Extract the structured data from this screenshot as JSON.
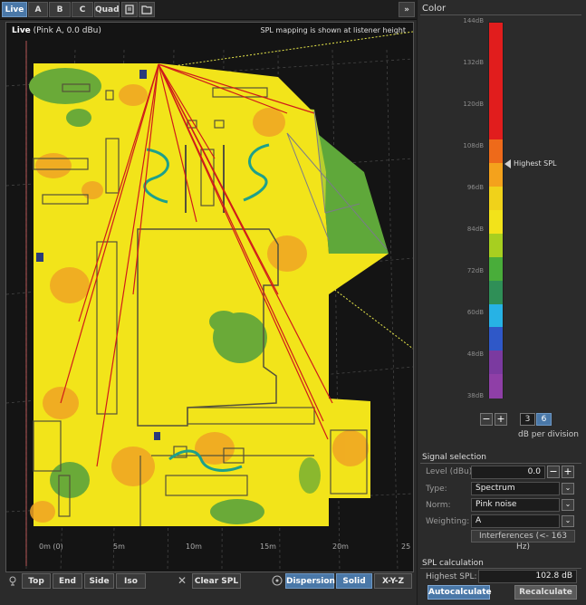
{
  "tabs": [
    "Live",
    "A",
    "B",
    "C",
    "Quad"
  ],
  "tab_icons": [
    "notes-icon",
    "folder-icon"
  ],
  "expand_glyph": "»",
  "viewport": {
    "title": "Live",
    "subtitle": "(Pink A, 0.0 dBu)",
    "note": "SPL mapping is shown at listener height",
    "axis_labels": [
      "0m (0)",
      "5m",
      "10m",
      "15m",
      "20m",
      "25"
    ]
  },
  "bottom_bar": {
    "views": [
      "Top",
      "End",
      "Side",
      "Iso"
    ],
    "clear_label": "Clear SPL",
    "modes": [
      "Dispersion",
      "Solid",
      "X-Y-Z"
    ]
  },
  "color_panel": {
    "title": "Color",
    "scale_labels": [
      "144dB",
      "132dB",
      "120dB",
      "108dB",
      "96dB",
      "84dB",
      "72dB",
      "60dB",
      "48dB",
      "38dB"
    ],
    "highest_label": "Highest SPL",
    "db_per_division_options": [
      "3",
      "6"
    ],
    "db_per_division_selected": "6",
    "db_per_division_label": "dB per division",
    "minus_label": "−",
    "plus_label": "+",
    "band_colors": [
      "#e11d1d",
      "#e11d1d",
      "#e11d1d",
      "#e11d1d",
      "#e11d1d",
      "#ee6a1a",
      "#f4a21c",
      "#f0d21a",
      "#f2e31a",
      "#a7cf20",
      "#49ad3a",
      "#2f8f57",
      "#27b2e5",
      "#2f58c8",
      "#7b3aa0",
      "#8f3fa7"
    ]
  },
  "signal_selection": {
    "title": "Signal selection",
    "level_label": "Level (dBu):",
    "level_value": "0.0",
    "type_label": "Type:",
    "type_value": "Spectrum",
    "norm_label": "Norm:",
    "norm_value": "Pink noise",
    "weighting_label": "Weighting:",
    "weighting_value": "A",
    "interferences_label": "Interferences (<- 163 Hz)"
  },
  "spl_calculation": {
    "title": "SPL calculation",
    "highest_label": "Highest SPL:",
    "highest_value": "102.8 dB",
    "autocalculate_label": "Autocalculate",
    "recalculate_label": "Recalculate"
  },
  "icons": {
    "bottom_left": "eye-icon",
    "clear": "close-icon",
    "mode": "toggle-icon",
    "marker": "triangle-pointer-icon"
  }
}
